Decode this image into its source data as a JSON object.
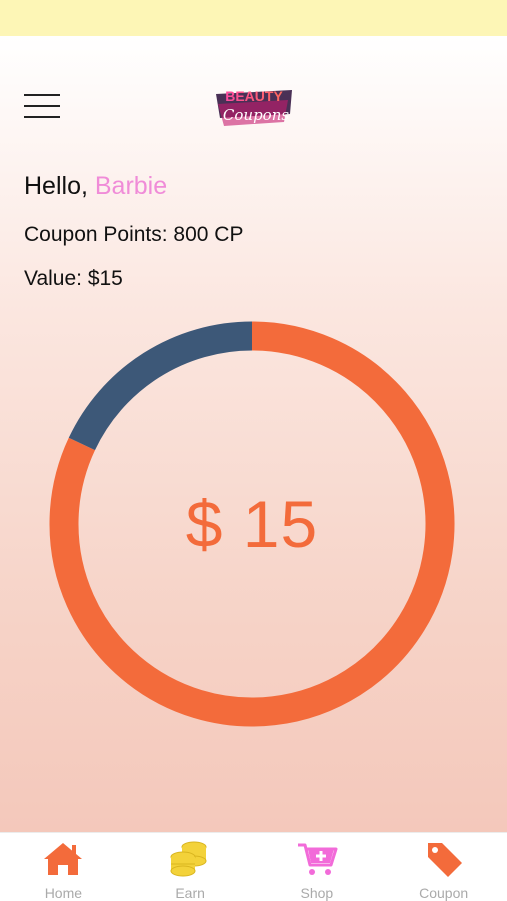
{
  "header": {
    "menu_icon": "hamburger-menu-icon",
    "logo": {
      "line1": "BEAUTY",
      "line2": "Coupons"
    }
  },
  "greeting": {
    "prefix": "Hello, ",
    "name": "Barbie"
  },
  "points_text": "Coupon Points: 800 CP",
  "value_text": "Value: $15",
  "chart_data": {
    "type": "pie",
    "center_label": "$ 15",
    "slices": [
      {
        "value": 82,
        "color": "#f36b3b"
      },
      {
        "value": 18,
        "color": "#3d5878"
      }
    ]
  },
  "tabs": [
    {
      "label": "Home",
      "icon": "home-icon",
      "active": true,
      "color": "#f36b3b"
    },
    {
      "label": "Earn",
      "icon": "coins-icon",
      "active": false,
      "color": "#f3d23a"
    },
    {
      "label": "Shop",
      "icon": "shopping-cart-icon",
      "active": false,
      "color": "#f26bd9"
    },
    {
      "label": "Coupon",
      "icon": "tag-icon",
      "active": false,
      "color": "#f36b3b"
    }
  ],
  "colors": {
    "status_bar": "#fdf6b6",
    "accent_orange": "#f36b3b",
    "accent_navy": "#3d5878",
    "accent_pink": "#f08cd8"
  }
}
